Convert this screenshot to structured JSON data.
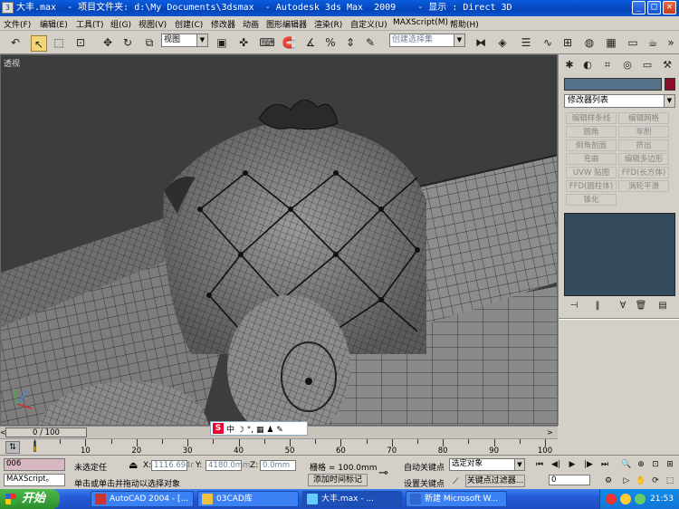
{
  "window": {
    "title": "大丰.max  - 项目文件夹: d:\\My Documents\\3dsmax  - Autodesk 3ds Max  2009    - 显示 : Direct 3D",
    "min_label": "_",
    "max_label": "□",
    "close_label": "✕"
  },
  "menu": {
    "items": [
      "文件(F)",
      "编辑(E)",
      "工具(T)",
      "组(G)",
      "视图(V)",
      "创建(C)",
      "修改器",
      "动画",
      "图形编辑器",
      "渲染(R)",
      "自定义(U)",
      "MAXScript(M)",
      "帮助(H)"
    ]
  },
  "toolbar": {
    "view_dropdown": "视图",
    "selection_set_dropdown": "创建选择集"
  },
  "viewport": {
    "label": "透视",
    "background": "#3d3d3d"
  },
  "command_panel": {
    "modifier_list": "修改器列表",
    "modifier_buttons": [
      "编辑样条线",
      "编辑网格",
      "圆角",
      "车削",
      "倒角剖面",
      "挤出",
      "弯曲",
      "编辑多边形",
      "UVW 贴图",
      "FFD(长方体)",
      "FFD(圆柱体)",
      "涡轮平滑",
      "锥化"
    ],
    "object_color": "#8b0f2a"
  },
  "ime": {
    "s_label": "S",
    "chars": "中 ☽ °, ▦ ♟ ✎"
  },
  "timeline": {
    "current": "0 / 100",
    "prev_label": "<",
    "next_label": ">",
    "tick_labels": [
      "10",
      "20",
      "30",
      "40",
      "50",
      "60",
      "70",
      "80",
      "90",
      "100"
    ]
  },
  "status": {
    "object_name": "006",
    "maxscript_label": "MAXScript。",
    "selection_status": "未选定任",
    "prompt": "单击或单击并拖动以选择对象",
    "x_label": "X:",
    "x_value": "1116.694r",
    "y_label": "Y:",
    "y_value": "4180.0mm",
    "z_label": "Z:",
    "z_value": "0.0mm",
    "grid": "栅格 = 100.0mm",
    "add_time_tag": "添加时间标记",
    "auto_key": "自动关键点",
    "set_key": "设置关键点",
    "selected_object": "选定对象",
    "key_filters": "关键点过滤器...",
    "frame_value": "0"
  },
  "taskbar": {
    "start_label": "开始",
    "tasks": [
      "AutoCAD 2004 - [...",
      "03CAD库",
      "大丰.max - ...",
      "新建 Microsoft W..."
    ],
    "clock": "21:53"
  }
}
